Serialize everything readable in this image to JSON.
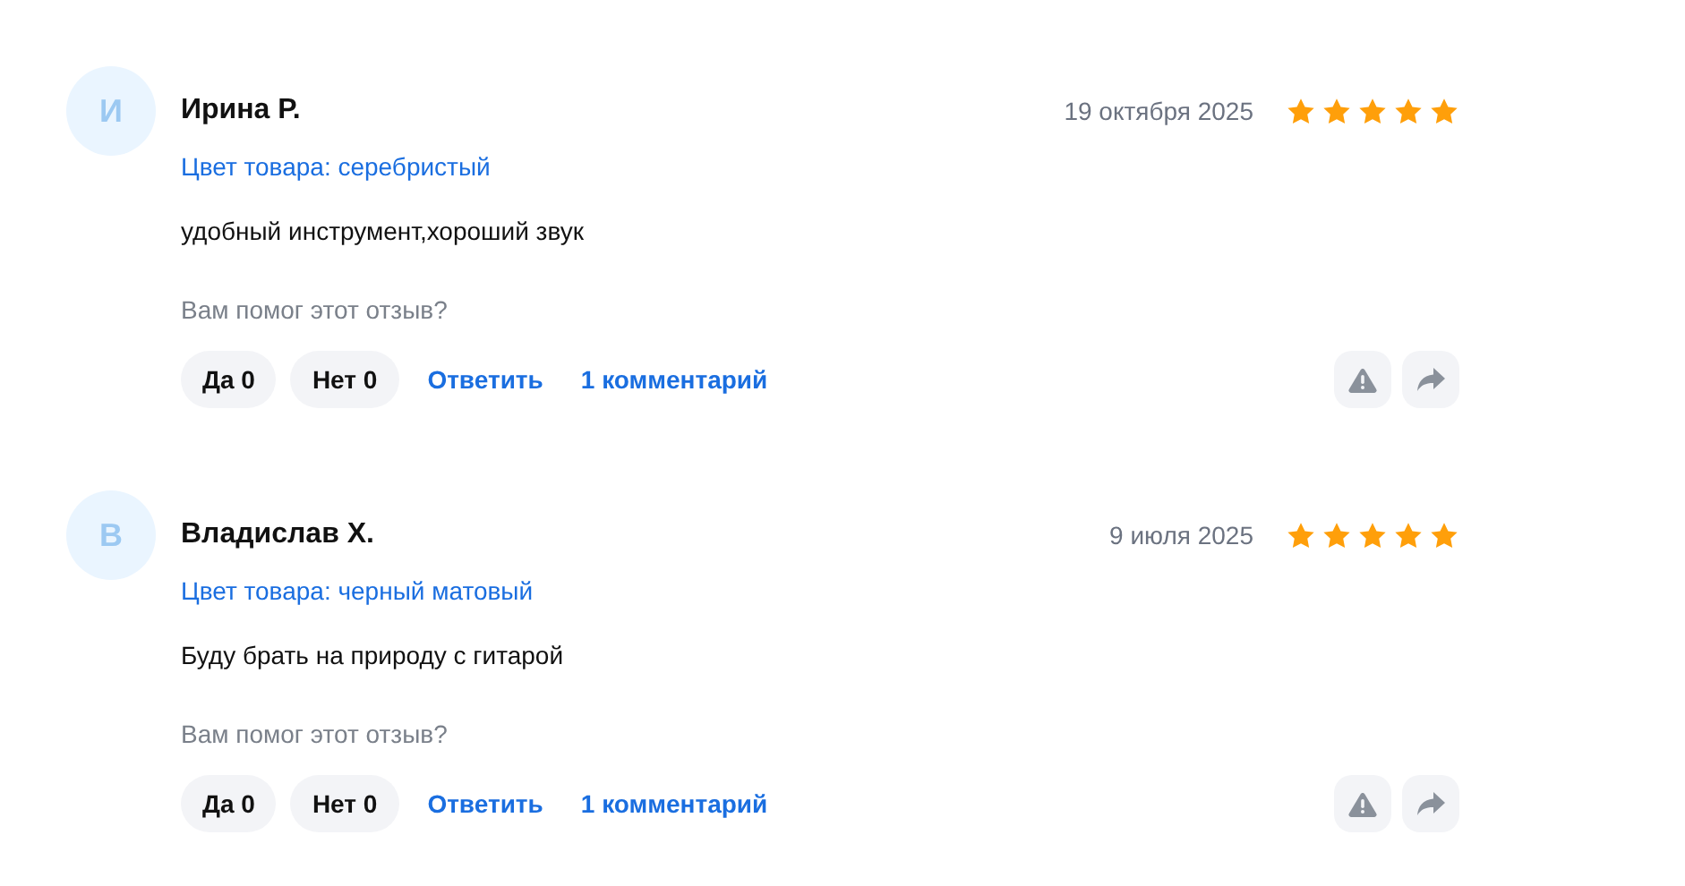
{
  "reviews": [
    {
      "avatar_letter": "И",
      "author": "Ирина Р.",
      "date": "19 октября 2025",
      "stars": 5,
      "variant": "Цвет товара: серебристый",
      "text": "удобный инструмент,хороший звук",
      "helpful_question": "Вам помог этот отзыв?",
      "yes": "Да 0",
      "no": "Нет 0",
      "reply": "Ответить",
      "comments": "1 комментарий"
    },
    {
      "avatar_letter": "В",
      "author": "Владислав Х.",
      "date": "9 июля 2025",
      "stars": 5,
      "variant": "Цвет товара: черный матовый",
      "text": "Буду брать на природу с гитарой",
      "helpful_question": "Вам помог этот отзыв?",
      "yes": "Да 0",
      "no": "Нет 0",
      "reply": "Ответить",
      "comments": "1 комментарий"
    }
  ]
}
